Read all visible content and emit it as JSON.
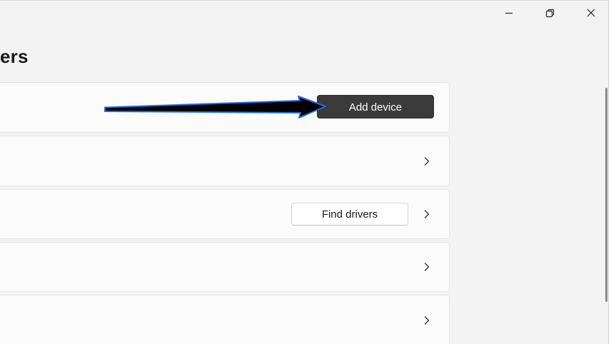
{
  "window": {
    "title": "ers",
    "caption": {
      "minimize_icon": "minimize-icon",
      "restore_icon": "restore-icon",
      "close_icon": "close-icon"
    }
  },
  "cards": {
    "add_device": {
      "button_label": "Add device"
    },
    "row_2": {
      "chevron_icon": "chevron-right-icon"
    },
    "find_drivers": {
      "button_label": "Find drivers",
      "chevron_icon": "chevron-right-icon"
    },
    "row_4": {
      "chevron_icon": "chevron-right-icon"
    },
    "row_5": {
      "chevron_icon": "chevron-right-icon"
    }
  },
  "annotation": {
    "arrow_icon": "arrow-right-icon",
    "arrow_fill": "#000000",
    "arrow_outline": "#1e6ee8"
  },
  "colors": {
    "window_bg": "#f3f3f3",
    "card_bg": "#fbfbfb",
    "primary_button_bg": "#3b3b3b",
    "primary_button_text": "#ffffff",
    "secondary_button_bg": "#ffffff"
  }
}
